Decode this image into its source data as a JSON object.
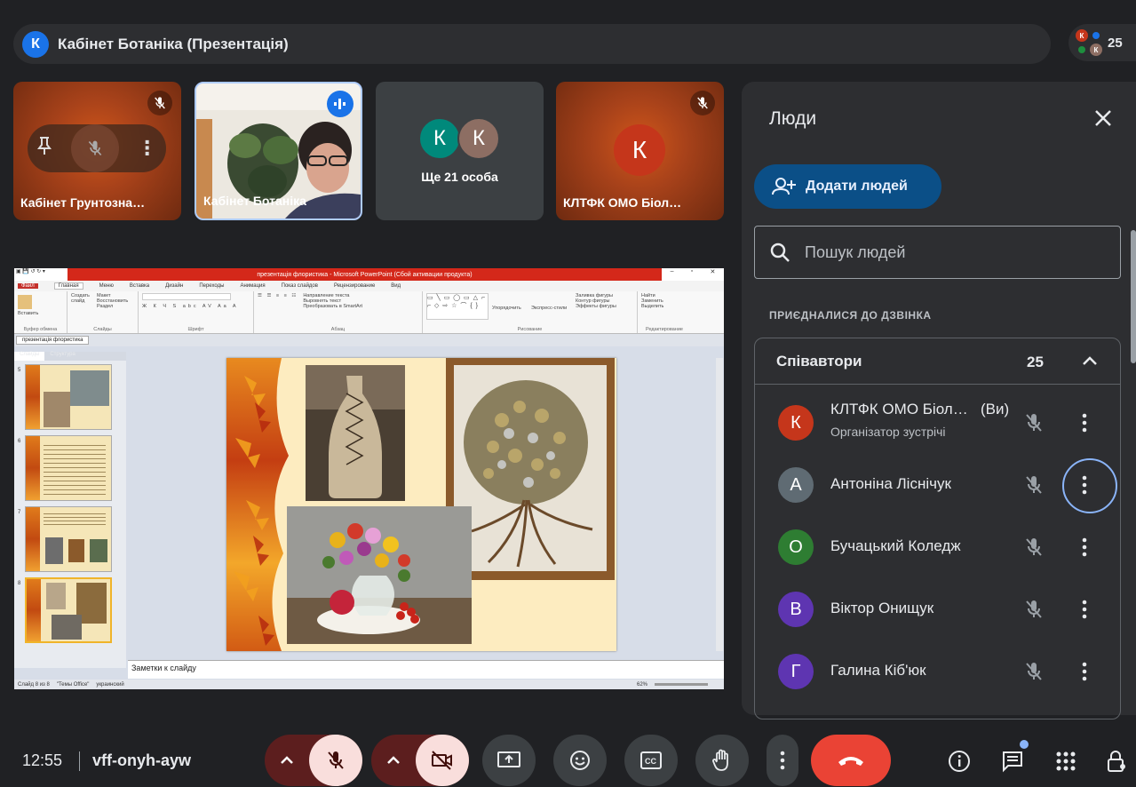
{
  "meeting": {
    "title_initial": "К",
    "title": "Кабінет Ботаніка (Презентація)",
    "participant_count": "25"
  },
  "tiles": [
    {
      "name": "Кабінет Грунтозна…"
    },
    {
      "name": "Кабінет Ботаніка"
    },
    {
      "label": "Ще 21 особа",
      "avatar1": "К",
      "avatar2": "К"
    },
    {
      "name": "КЛТФК ОМО Біол…",
      "avatar": "К"
    }
  ],
  "hover_controls": {
    "pin": "📌",
    "more": "⋮"
  },
  "presentation": {
    "window_title": "презентація флористика - Microsoft PowerPoint (Сбой активации продукта)",
    "menu": [
      "Файл",
      "Главная",
      "Меню",
      "Вставка",
      "Дизайн",
      "Переходы",
      "Анимация",
      "Показ слайдов",
      "Рецензирование",
      "Вид"
    ],
    "groups": [
      "Буфер обмена",
      "Слайды",
      "Шрифт",
      "Абзац",
      "Рисование",
      "Редактирование"
    ],
    "ribbon": {
      "paste": "Вставить",
      "create_slide": "Создать слайд",
      "layout": "Макет",
      "restore": "Восстановить",
      "section": "Раздел",
      "text_dir": "Направление текста",
      "align_text": "Выровнять текст",
      "smartart": "Преобразовать в SmartArt",
      "arrange": "Упорядочить",
      "styles": "Экспресс-стили",
      "fill": "Заливка фигуры",
      "outline": "Контур фигуры",
      "effects": "Эффекты фигуры",
      "find": "Найти",
      "replace": "Заменить",
      "select": "Выделить"
    },
    "doc_tab": "презентація флористика",
    "pane_tabs": [
      "Слайды",
      "Структура"
    ],
    "slide_numbers": [
      "5",
      "6",
      "7",
      "8"
    ],
    "notes": "Заметки к слайду",
    "status": [
      "Слайд 8 из 8",
      "\"Темы Office\"",
      "украинский"
    ],
    "zoom": "62%"
  },
  "panel": {
    "title": "Люди",
    "add_people": "Додати людей",
    "search_placeholder": "Пошук людей",
    "section": "ПРИЄДНАЛИСЯ ДО ДЗВІНКА",
    "group": "Співавтори",
    "group_count": "25",
    "people": [
      {
        "initial": "К",
        "name": "КЛТФК ОМО Біол…",
        "you": "(Ви)",
        "role": "Організатор зустрічі",
        "color": "#c5361b"
      },
      {
        "initial": "А",
        "name": "Антоніна Ліснічук",
        "color": "#5f6b73"
      },
      {
        "initial": "О",
        "name": "Бучацький Коледж",
        "color": "#2e7d32"
      },
      {
        "initial": "В",
        "name": "Віктор Онищук",
        "color": "#5e35b1"
      },
      {
        "initial": "Г",
        "name": "Галина Кіб'юк",
        "color": "#5e35b1"
      }
    ]
  },
  "bottom": {
    "time": "12:55",
    "meeting_code": "vff-onyh-ayw"
  }
}
